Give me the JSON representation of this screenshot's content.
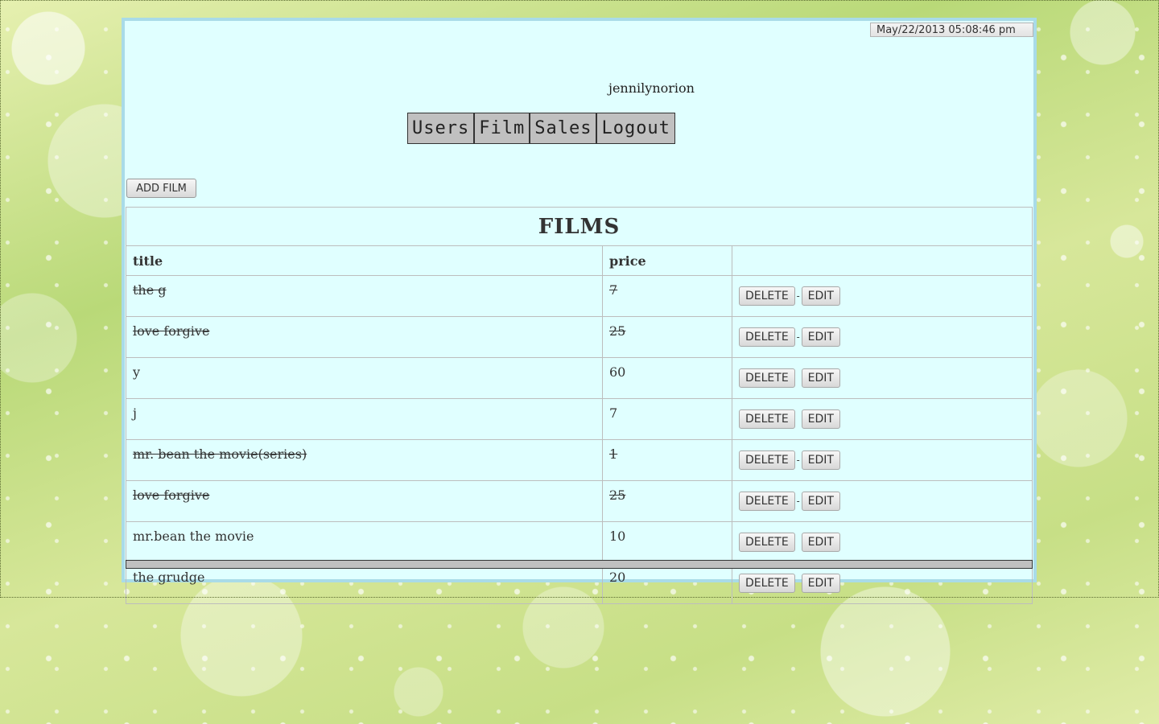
{
  "header": {
    "datetime": "May/22/2013 05:08:46 pm",
    "username": "jennilynorion"
  },
  "nav": {
    "items": [
      {
        "label": "Users"
      },
      {
        "label": "Film"
      },
      {
        "label": "Sales"
      },
      {
        "label": "Logout"
      }
    ]
  },
  "toolbar": {
    "add_film_label": "ADD FILM"
  },
  "films_table": {
    "caption": "FILMS",
    "columns": [
      "title",
      "price",
      ""
    ],
    "delete_label": "DELETE",
    "edit_label": "EDIT",
    "separator": "-",
    "rows": [
      {
        "title": "the g",
        "price": "7",
        "struck": true
      },
      {
        "title": "love forgive",
        "price": "25",
        "struck": true
      },
      {
        "title": "y",
        "price": "60",
        "struck": false
      },
      {
        "title": "j",
        "price": "7",
        "struck": false
      },
      {
        "title": "mr. bean the movie(series)",
        "price": "1",
        "struck": true
      },
      {
        "title": "love forgive",
        "price": "25",
        "struck": true
      },
      {
        "title": "mr.bean the movie",
        "price": "10",
        "struck": false
      },
      {
        "title": "the grudge",
        "price": "20",
        "struck": false
      }
    ]
  }
}
